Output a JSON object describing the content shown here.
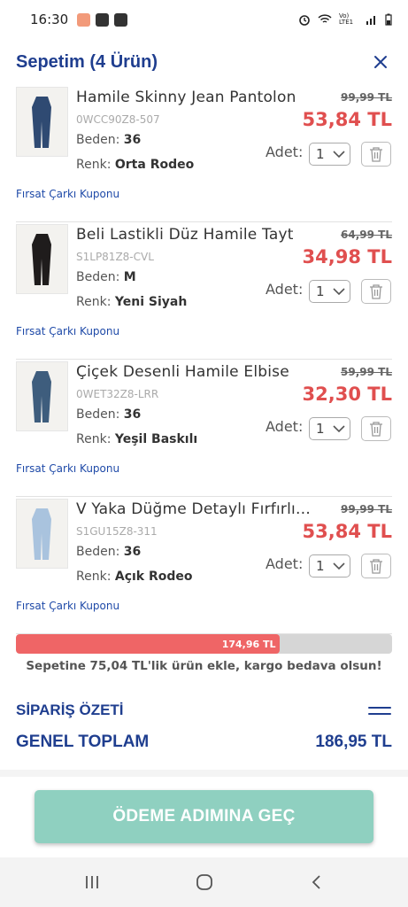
{
  "status_bar": {
    "time": "16:30",
    "network": "Vo) LTE1"
  },
  "header": {
    "title": "Sepetim (4 Ürün)"
  },
  "items": [
    {
      "name": "Hamile Skinny Jean Pantolon",
      "sku": "0WCC90Z8-507",
      "beden_label": "Beden:",
      "beden": "36",
      "renk_label": "Renk:",
      "renk": "Orta Rodeo",
      "old_price": "99,99 TL",
      "new_price": "53,84 TL",
      "adet_label": "Adet:",
      "qty": "1",
      "coupon": "Fırsat Çarkı Kuponu",
      "thumb_color": "#2f4a72"
    },
    {
      "name": "Beli Lastikli Düz Hamile Tayt",
      "sku": "S1LP81Z8-CVL",
      "beden_label": "Beden:",
      "beden": "M",
      "renk_label": "Renk:",
      "renk": "Yeni Siyah",
      "old_price": "64,99 TL",
      "new_price": "34,98 TL",
      "adet_label": "Adet:",
      "qty": "1",
      "coupon": "Fırsat Çarkı Kuponu",
      "thumb_color": "#1f1c1c"
    },
    {
      "name": "Çiçek Desenli Hamile Elbise",
      "sku": "0WET32Z8-LRR",
      "beden_label": "Beden:",
      "beden": "36",
      "renk_label": "Renk:",
      "renk": "Yeşil Baskılı",
      "old_price": "59,99 TL",
      "new_price": "32,30 TL",
      "adet_label": "Adet:",
      "qty": "1",
      "coupon": "Fırsat Çarkı Kuponu",
      "thumb_color": "#3e5d7d"
    },
    {
      "name": "V Yaka Düğme Detaylı Fırfırlı ...",
      "sku": "S1GU15Z8-311",
      "beden_label": "Beden:",
      "beden": "36",
      "renk_label": "Renk:",
      "renk": "Açık Rodeo",
      "old_price": "99,99 TL",
      "new_price": "53,84 TL",
      "adet_label": "Adet:",
      "qty": "1",
      "coupon": "Fırsat Çarkı Kuponu",
      "thumb_color": "#a9c3de"
    }
  ],
  "progress": {
    "label": "174,96 TL",
    "fraction": 0.7
  },
  "free_shipping_text": "Sepetine 75,04 TL'lik ürün ekle, kargo bedava olsun!",
  "summary": {
    "title": "SİPARİŞ ÖZETİ",
    "total_label": "GENEL TOPLAM",
    "total_value": "186,95 TL"
  },
  "pay_button": {
    "label": "ÖDEME ADIMINA GEÇ"
  },
  "colors": {
    "accent": "#1f3e8f",
    "price_red": "#e04f4f",
    "button_teal": "#8fd0c0",
    "progress_red": "#ef6566"
  },
  "icons": {
    "close": "close-icon",
    "trash": "trash-icon",
    "chevron": "chevron-down-icon"
  }
}
